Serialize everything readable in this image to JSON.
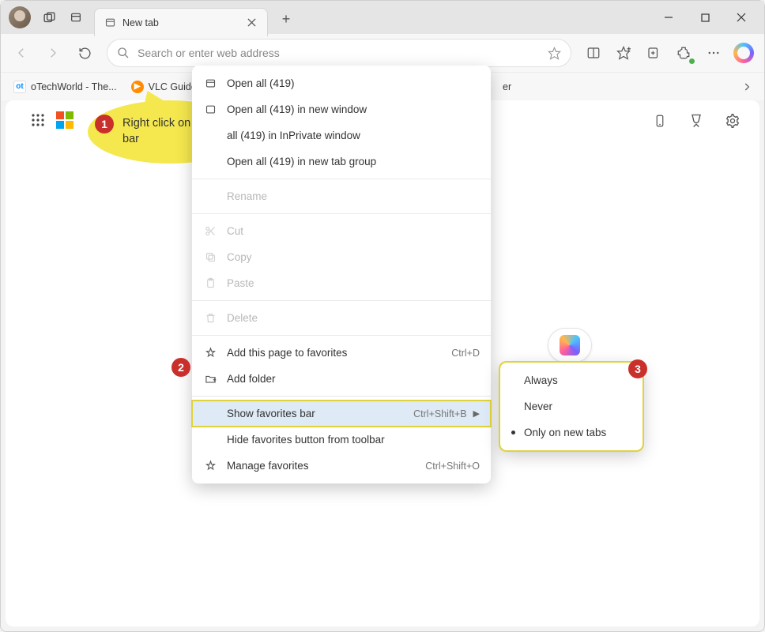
{
  "tab": {
    "title": "New tab"
  },
  "addressbar": {
    "placeholder": "Search or enter web address"
  },
  "favorites": {
    "items": [
      {
        "label": "oTechWorld - The..."
      },
      {
        "label": "VLC Guide"
      }
    ],
    "partial_visible": "er"
  },
  "callout": {
    "text": "Right click on Favorites bar"
  },
  "badges": {
    "b1": "1",
    "b2": "2",
    "b3": "3"
  },
  "ctx": {
    "open_all": "Open all (419)",
    "open_all_new_window": "Open all (419) in new window",
    "open_all_inprivate": "all (419) in InPrivate window",
    "open_all_tab_group": "Open all (419) in new tab group",
    "rename": "Rename",
    "cut": "Cut",
    "copy": "Copy",
    "paste": "Paste",
    "delete": "Delete",
    "add_page": "Add this page to favorites",
    "add_page_shortcut": "Ctrl+D",
    "add_folder": "Add folder",
    "show_favbar": "Show favorites bar",
    "show_favbar_shortcut": "Ctrl+Shift+B",
    "hide_favbtn": "Hide favorites button from toolbar",
    "manage": "Manage favorites",
    "manage_shortcut": "Ctrl+Shift+O"
  },
  "submenu": {
    "items": [
      "Always",
      "Never",
      "Only on new tabs"
    ],
    "selected_index": 2
  }
}
